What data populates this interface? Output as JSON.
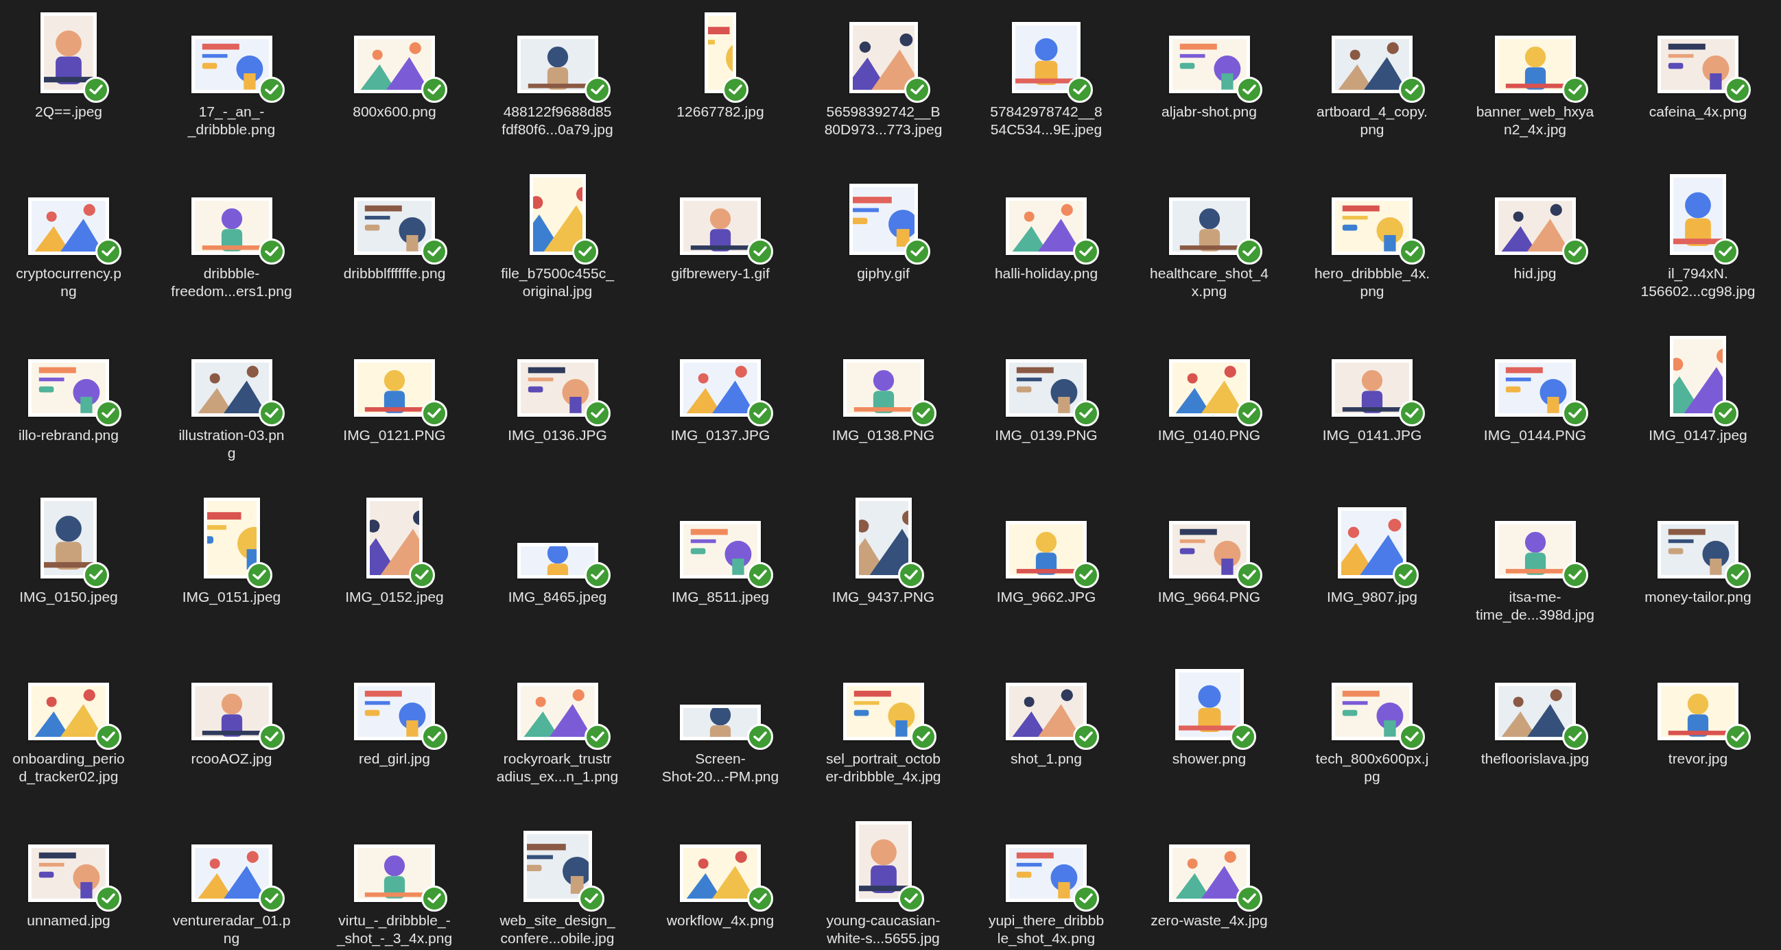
{
  "files": [
    {
      "name": "2Q==.jpeg",
      "kind": "portrait",
      "synced": true
    },
    {
      "name": "17_-_an_-\n_dribbble.png",
      "kind": "landscape",
      "synced": true
    },
    {
      "name": "800x600.png",
      "kind": "landscape",
      "synced": true
    },
    {
      "name": "488122f9688d85\nfdf80f6...0a79.jpg",
      "kind": "landscape",
      "synced": true
    },
    {
      "name": "12667782.jpg",
      "kind": "tall",
      "synced": true
    },
    {
      "name": "56598392742__B\n80D973...773.jpeg",
      "kind": "square",
      "synced": true
    },
    {
      "name": "57842978742__8\n54C534...9E.jpeg",
      "kind": "square",
      "synced": true
    },
    {
      "name": "aljabr-shot.png",
      "kind": "landscape",
      "synced": true
    },
    {
      "name": "artboard_4_copy.\npng",
      "kind": "landscape",
      "synced": true
    },
    {
      "name": "banner_web_hxya\nn2_4x.jpg",
      "kind": "landscape",
      "synced": true
    },
    {
      "name": "cafeina_4x.png",
      "kind": "landscape",
      "synced": true
    },
    {
      "name": "cryptocurrency.p\nng",
      "kind": "landscape",
      "synced": true
    },
    {
      "name": "dribbble-\nfreedom...ers1.png",
      "kind": "landscape",
      "synced": true
    },
    {
      "name": "dribbblffffffe.png",
      "kind": "landscape",
      "synced": true
    },
    {
      "name": "file_b7500c455c_\noriginal.jpg",
      "kind": "portrait",
      "synced": true
    },
    {
      "name": "gifbrewery-1.gif",
      "kind": "landscape",
      "synced": true
    },
    {
      "name": "giphy.gif",
      "kind": "square",
      "synced": true
    },
    {
      "name": "halli-holiday.png",
      "kind": "landscape",
      "synced": true
    },
    {
      "name": "healthcare_shot_4\nx.png",
      "kind": "landscape",
      "synced": true
    },
    {
      "name": "hero_dribbble_4x.\npng",
      "kind": "landscape",
      "synced": true
    },
    {
      "name": "hid.jpg",
      "kind": "landscape",
      "synced": true
    },
    {
      "name": "il_794xN.\n156602...cg98.jpg",
      "kind": "portrait",
      "synced": true
    },
    {
      "name": "illo-rebrand.png",
      "kind": "landscape",
      "synced": true
    },
    {
      "name": "illustration-03.pn\ng",
      "kind": "landscape",
      "synced": true
    },
    {
      "name": "IMG_0121.PNG",
      "kind": "landscape",
      "synced": true
    },
    {
      "name": "IMG_0136.JPG",
      "kind": "landscape",
      "synced": true
    },
    {
      "name": "IMG_0137.JPG",
      "kind": "landscape",
      "synced": true
    },
    {
      "name": "IMG_0138.PNG",
      "kind": "landscape",
      "synced": true
    },
    {
      "name": "IMG_0139.PNG",
      "kind": "landscape",
      "synced": true
    },
    {
      "name": "IMG_0140.PNG",
      "kind": "landscape",
      "synced": true
    },
    {
      "name": "IMG_0141.JPG",
      "kind": "landscape",
      "synced": true
    },
    {
      "name": "IMG_0144.PNG",
      "kind": "landscape",
      "synced": true
    },
    {
      "name": "IMG_0147.jpeg",
      "kind": "portrait",
      "synced": true
    },
    {
      "name": "IMG_0150.jpeg",
      "kind": "portrait",
      "synced": true
    },
    {
      "name": "IMG_0151.jpeg",
      "kind": "portrait",
      "synced": true
    },
    {
      "name": "IMG_0152.jpeg",
      "kind": "portrait",
      "synced": true
    },
    {
      "name": "IMG_8465.jpeg",
      "kind": "wide",
      "synced": true
    },
    {
      "name": "IMG_8511.jpeg",
      "kind": "landscape",
      "synced": true
    },
    {
      "name": "IMG_9437.PNG",
      "kind": "portrait",
      "synced": true
    },
    {
      "name": "IMG_9662.JPG",
      "kind": "landscape",
      "synced": true
    },
    {
      "name": "IMG_9664.PNG",
      "kind": "landscape",
      "synced": true
    },
    {
      "name": "IMG_9807.jpg",
      "kind": "square",
      "synced": true
    },
    {
      "name": "itsa-me-\ntime_de...398d.jpg",
      "kind": "landscape",
      "synced": true
    },
    {
      "name": "money-tailor.png",
      "kind": "landscape",
      "synced": true
    },
    {
      "name": "onboarding_perio\nd_tracker02.jpg",
      "kind": "landscape",
      "synced": true
    },
    {
      "name": "rcooAOZ.jpg",
      "kind": "landscape",
      "synced": true
    },
    {
      "name": "red_girl.jpg",
      "kind": "landscape",
      "synced": true
    },
    {
      "name": "rockyroark_trustr\nadius_ex...n_1.png",
      "kind": "landscape",
      "synced": true
    },
    {
      "name": "Screen-\nShot-20...-PM.png",
      "kind": "wide",
      "synced": true
    },
    {
      "name": "sel_portrait_octob\ner-dribbble_4x.jpg",
      "kind": "landscape",
      "synced": true
    },
    {
      "name": "shot_1.png",
      "kind": "landscape",
      "synced": true
    },
    {
      "name": "shower.png",
      "kind": "square",
      "synced": true
    },
    {
      "name": "tech_800x600px.j\npg",
      "kind": "landscape",
      "synced": true
    },
    {
      "name": "thefloorislava.jpg",
      "kind": "landscape",
      "synced": true
    },
    {
      "name": "trevor.jpg",
      "kind": "landscape",
      "synced": true
    },
    {
      "name": "unnamed.jpg",
      "kind": "landscape",
      "synced": true
    },
    {
      "name": "ventureradar_01.p\nng",
      "kind": "landscape",
      "synced": true
    },
    {
      "name": "virtu_-_dribbble_-\n_shot_-_3_4x.png",
      "kind": "landscape",
      "synced": true
    },
    {
      "name": "web_site_design_\nconfere...obile.jpg",
      "kind": "square",
      "synced": true
    },
    {
      "name": "workflow_4x.png",
      "kind": "landscape",
      "synced": true
    },
    {
      "name": "young-caucasian-\nwhite-s...5655.jpg",
      "kind": "portrait",
      "synced": true
    },
    {
      "name": "yupi_there_dribbb\nle_shot_4x.png",
      "kind": "landscape",
      "synced": true
    },
    {
      "name": "zero-waste_4x.jpg",
      "kind": "landscape",
      "synced": true
    }
  ]
}
